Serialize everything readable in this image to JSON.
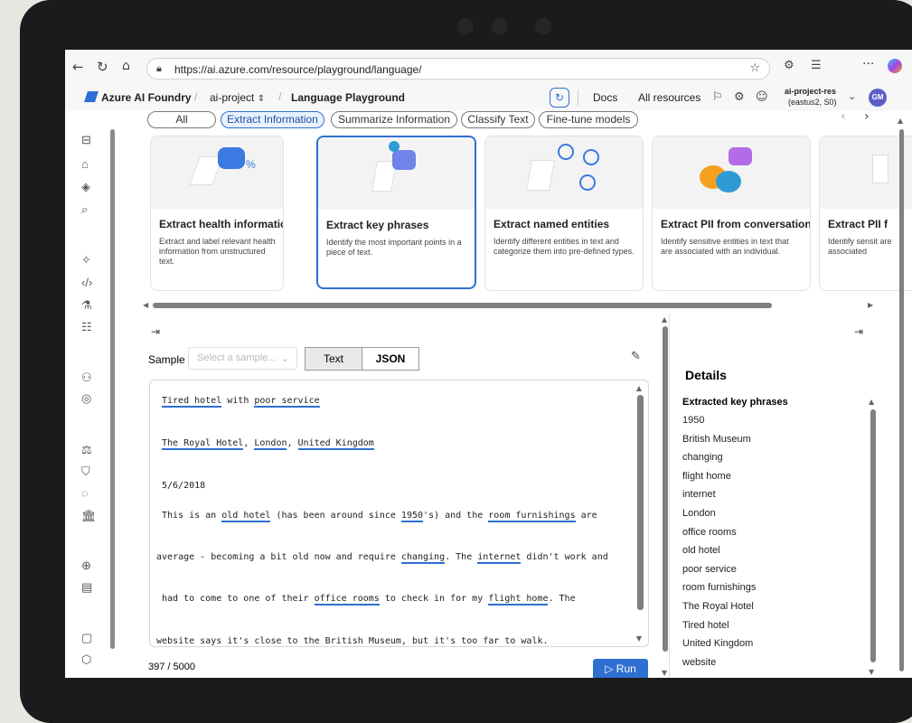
{
  "browser": {
    "url": "https://ai.azure.com/resource/playground/language/"
  },
  "app": {
    "brand": "Azure AI Foundry",
    "breadcrumb_project": "ai-project",
    "breadcrumb_page": "Language Playground",
    "docs": "Docs",
    "all_resources": "All resources",
    "account_name": "ai-project-res",
    "account_region": "(eastus2, S0)",
    "avatar_initials": "GM",
    "accent": "#2f6fd1"
  },
  "tabs": [
    {
      "label": "All"
    },
    {
      "label": "Extract Information"
    },
    {
      "label": "Summarize Information"
    },
    {
      "label": "Classify Text"
    },
    {
      "label": "Fine-tune models"
    }
  ],
  "cards": [
    {
      "title": "Extract health information",
      "desc": "Extract and label relevant health information from unstructured text."
    },
    {
      "title": "Extract key phrases",
      "desc": "Identify the most important points in a piece of text."
    },
    {
      "title": "Extract named entities",
      "desc": "Identify different entities in text and categorize them into pre-defined types."
    },
    {
      "title": "Extract PII from conversation",
      "desc": "Identify sensitive entities in text that are associated with an individual."
    },
    {
      "title": "Extract PII f",
      "desc": "Identify sensit are associated"
    }
  ],
  "editor": {
    "sample_label": "Sample",
    "sample_placeholder": "Select a sample...",
    "text_tab": "Text",
    "json_tab": "JSON",
    "char_count": "397 / 5000",
    "run_label": "Run",
    "lines": [
      [
        {
          "t": "Tired hotel",
          "k": true
        },
        {
          "t": " with "
        },
        {
          "t": "poor service",
          "k": true
        }
      ],
      [
        {
          "t": "The Royal Hotel",
          "k": true
        },
        {
          "t": ", "
        },
        {
          "t": "London",
          "k": true
        },
        {
          "t": ", "
        },
        {
          "t": "United Kingdom",
          "k": true
        }
      ],
      [
        {
          "t": "5/6/2018"
        }
      ],
      [
        {
          "t": "This is an "
        },
        {
          "t": "old hotel",
          "k": true
        },
        {
          "t": " (has been around since "
        },
        {
          "t": "1950",
          "k": true
        },
        {
          "t": "'s) and the "
        },
        {
          "t": "room furnishings",
          "k": true
        },
        {
          "t": " are"
        }
      ],
      [
        {
          "t": "average - becoming a bit old now and require "
        },
        {
          "t": "changing",
          "k": true
        },
        {
          "t": ". The "
        },
        {
          "t": "internet",
          "k": true
        },
        {
          "t": " didn't work and"
        }
      ],
      [
        {
          "t": "had to come to one of their "
        },
        {
          "t": "office rooms",
          "k": true
        },
        {
          "t": " to check in for my "
        },
        {
          "t": "flight home",
          "k": true
        },
        {
          "t": ". The"
        }
      ],
      [
        {
          "t": "website",
          "k": true
        },
        {
          "t": " says it's close to the "
        },
        {
          "t": "British Museum",
          "k": true
        },
        {
          "t": ", but it's too far to walk."
        }
      ]
    ]
  },
  "details": {
    "heading": "Details",
    "section": "Extracted key phrases",
    "items": [
      "1950",
      "British Museum",
      "changing",
      "flight home",
      "internet",
      "London",
      "office rooms",
      "old hotel",
      "poor service",
      "room furnishings",
      "The Royal Hotel",
      "Tired hotel",
      "United Kingdom",
      "website"
    ]
  }
}
